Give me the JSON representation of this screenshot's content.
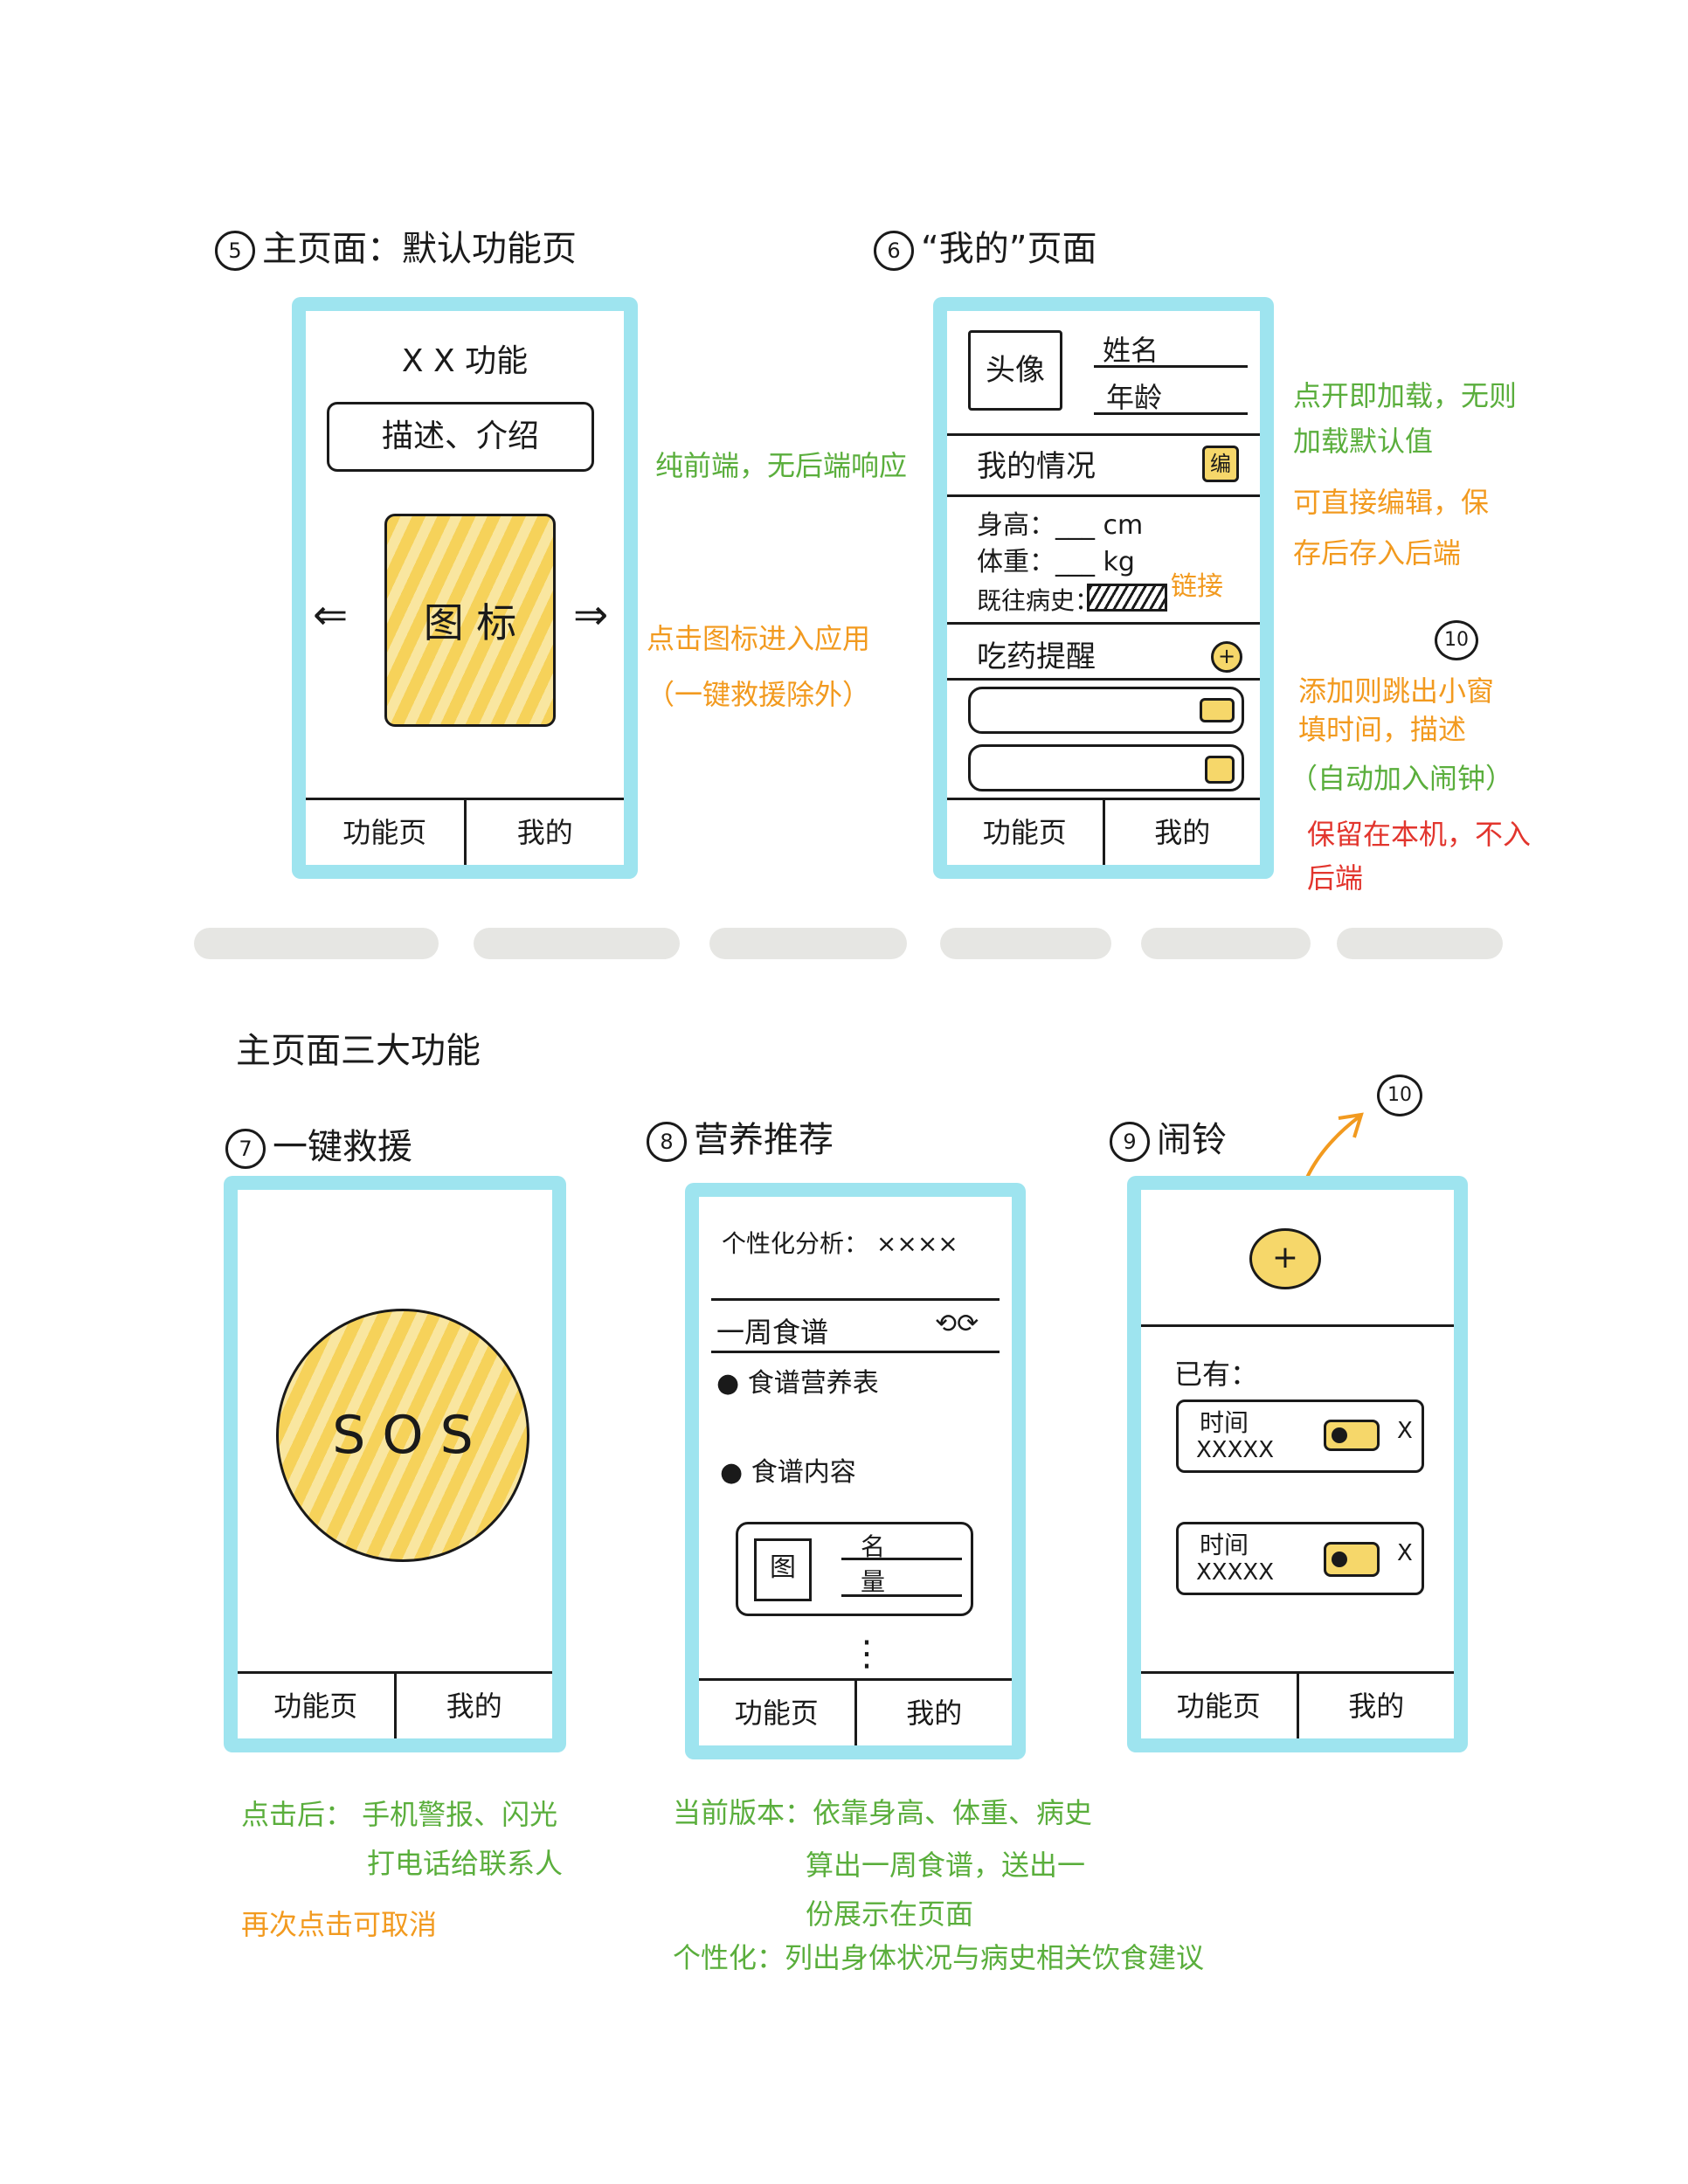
{
  "panel5": {
    "num": "5",
    "title": "主页面：默认功能页",
    "header": "X X 功能",
    "desc": "描述、介绍",
    "icon_label": "图 标",
    "arrow_left": "⇐",
    "arrow_right": "⇒",
    "tabs": [
      "功能页",
      "我的"
    ],
    "note1": "纯前端，无后端响应",
    "note2": "点击图标进入应用",
    "note3": "（一键救援除外）"
  },
  "panel6": {
    "num": "6",
    "title": "“我的”页面",
    "avatar": "头像",
    "name": "姓名",
    "age": "年龄",
    "section_my": "我的情况",
    "edit": "编",
    "height": "身高：___ cm",
    "weight": "体重：___ kg",
    "history": "既往病史：",
    "link": "链接",
    "section_med": "吃药提醒",
    "plus": "+",
    "tabs": [
      "功能页",
      "我的"
    ],
    "note_load1": "点开即加载，无则",
    "note_load2": "加载默认值",
    "note_edit1": "可直接编辑，保",
    "note_edit2": "存后存入后端",
    "badge10": "10",
    "note_add1": "添加则跳出小窗",
    "note_add2": "填时间，描述",
    "note_add3": "（自动加入闹钟）",
    "note_save1": "保留在本机，不入",
    "note_save2": "后端"
  },
  "section_title": "主页面三大功能",
  "panel7": {
    "num": "7",
    "title": "一键救援",
    "sos": "S O S",
    "tabs": [
      "功能页",
      "我的"
    ],
    "note1": "点击后：  手机警报、闪光",
    "note2": "打电话给联系人",
    "note3": "再次点击可取消"
  },
  "panel8": {
    "num": "8",
    "title": "营养推荐",
    "analysis": "个性化分析： ××××",
    "week": "一周食谱",
    "refresh": "⟲⟳",
    "bullet1": "食谱营养表",
    "bullet2": "食谱内容",
    "img": "图",
    "name": "名",
    "qty": "量",
    "more": "⋮",
    "tabs": [
      "功能页",
      "我的"
    ],
    "note1": "当前版本：依靠身高、体重、病史",
    "note2": "算出一周食谱，送出一",
    "note3": "份展示在页面",
    "note4": "个性化：列出身体状况与病史相关饮食建议"
  },
  "panel9": {
    "num": "9",
    "title": "闹铃",
    "plus": "+",
    "badge10": "10",
    "existing": "已有：",
    "alarms": [
      {
        "time": "时间",
        "desc": "XXXXX",
        "close": "X"
      },
      {
        "time": "时间",
        "desc": "XXXXX",
        "close": "X"
      }
    ],
    "tabs": [
      "功能页",
      "我的"
    ]
  },
  "colors": {
    "phone_border": "#9ee4ef",
    "highlight": "#f6d25a",
    "note_green": "#5aae3c",
    "note_orange": "#f29a1f",
    "note_red": "#e2352d",
    "separator": "#e6e6e3"
  }
}
